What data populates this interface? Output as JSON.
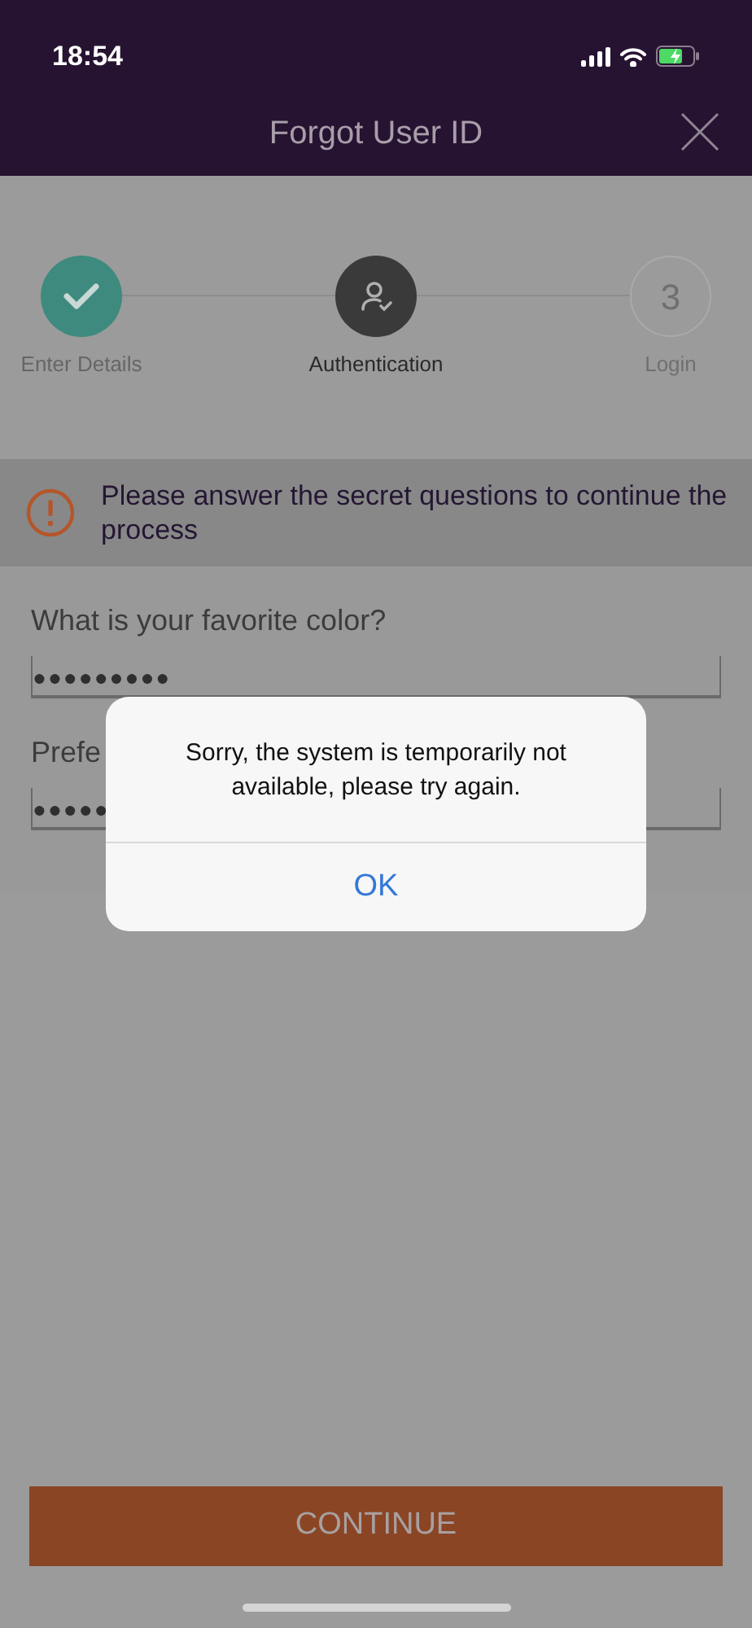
{
  "status_bar": {
    "time": "18:54"
  },
  "header": {
    "title": "Forgot User ID"
  },
  "steps": [
    {
      "label": "Enter Details",
      "kind": "done"
    },
    {
      "label": "Authentication",
      "kind": "current"
    },
    {
      "label": "Login",
      "kind": "pending",
      "number": "3"
    }
  ],
  "notice": {
    "text": "Please answer the secret questions to continue the process"
  },
  "questions": [
    {
      "label": "What is your favorite color?",
      "value": "●●●●●●●●●"
    },
    {
      "label": "Prefe",
      "value": "●●●●●"
    }
  ],
  "dialog": {
    "message": "Sorry, the system is temporarily not available, please try again.",
    "button": "OK"
  },
  "continue_button": "CONTINUE"
}
